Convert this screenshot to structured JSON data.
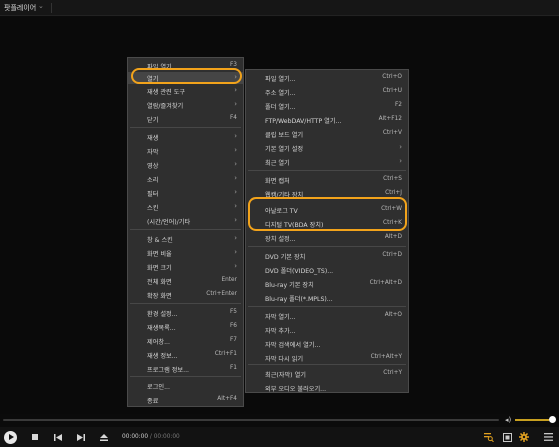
{
  "app": {
    "title": "팟플레이어",
    "chevron_icon": "chevron-down-icon"
  },
  "accent_color": "#f2a31b",
  "main_menu": {
    "items": [
      {
        "label": "파일 열기...",
        "shortcut": "F3",
        "arrow": ""
      },
      {
        "label": "열기",
        "shortcut": "",
        "arrow": "›"
      },
      {
        "label": "재생 관련 도구",
        "shortcut": "",
        "arrow": "›"
      },
      {
        "label": "열람/즐겨찾기",
        "shortcut": "",
        "arrow": "›"
      },
      {
        "label": "닫기",
        "shortcut": "F4",
        "arrow": ""
      },
      {
        "label": "재생",
        "shortcut": "",
        "arrow": "›"
      },
      {
        "label": "자막",
        "shortcut": "",
        "arrow": "›"
      },
      {
        "label": "영상",
        "shortcut": "",
        "arrow": "›"
      },
      {
        "label": "소리",
        "shortcut": "",
        "arrow": "›"
      },
      {
        "label": "필터",
        "shortcut": "",
        "arrow": "›"
      },
      {
        "label": "스킨",
        "shortcut": "",
        "arrow": "›"
      },
      {
        "label": "(시간/언어)/기타",
        "shortcut": "",
        "arrow": "›"
      },
      {
        "label": "창 & 스킨",
        "shortcut": "",
        "arrow": "›"
      },
      {
        "label": "화면 비율",
        "shortcut": "",
        "arrow": "›"
      },
      {
        "label": "화면 크기",
        "shortcut": "",
        "arrow": "›"
      },
      {
        "label": "전체 화면",
        "shortcut": "Enter",
        "arrow": ""
      },
      {
        "label": "확장 화면",
        "shortcut": "Ctrl+Enter",
        "arrow": ""
      },
      {
        "label": "환경 설정...",
        "shortcut": "F5",
        "arrow": ""
      },
      {
        "label": "재생목록...",
        "shortcut": "F6",
        "arrow": ""
      },
      {
        "label": "제어창...",
        "shortcut": "F7",
        "arrow": ""
      },
      {
        "label": "재생 정보...",
        "shortcut": "Ctrl+F1",
        "arrow": ""
      },
      {
        "label": "프로그램 정보...",
        "shortcut": "F1",
        "arrow": ""
      },
      {
        "label": "로그인...",
        "shortcut": "",
        "arrow": ""
      },
      {
        "label": "종료",
        "shortcut": "Alt+F4",
        "arrow": ""
      }
    ]
  },
  "open_submenu": {
    "items": [
      {
        "label": "파일 열기...",
        "shortcut": "Ctrl+O",
        "arrow": ""
      },
      {
        "label": "주소 열기...",
        "shortcut": "Ctrl+U",
        "arrow": ""
      },
      {
        "label": "폴더 열기...",
        "shortcut": "F2",
        "arrow": ""
      },
      {
        "label": "FTP/WebDAV/HTTP 열기...",
        "shortcut": "Alt+F12",
        "arrow": ""
      },
      {
        "label": "클립 보드 열기",
        "shortcut": "Ctrl+V",
        "arrow": ""
      },
      {
        "label": "기본 열기 설정",
        "shortcut": "",
        "arrow": "›"
      },
      {
        "label": "최근 열기",
        "shortcut": "",
        "arrow": "›"
      },
      {
        "label": "화면 캡처",
        "shortcut": "Ctrl+S",
        "arrow": ""
      },
      {
        "label": "웹캠/기타 장치",
        "shortcut": "Ctrl+J",
        "arrow": ""
      },
      {
        "label": "아날로그 TV",
        "shortcut": "Ctrl+W",
        "arrow": ""
      },
      {
        "label": "디지털 TV(BDA 장치)",
        "shortcut": "Ctrl+K",
        "arrow": ""
      },
      {
        "label": "장치 설정...",
        "shortcut": "Alt+D",
        "arrow": ""
      },
      {
        "label": "DVD 기본 장치",
        "shortcut": "Ctrl+D",
        "arrow": ""
      },
      {
        "label": "DVD 폴더(VIDEO_TS)...",
        "shortcut": "",
        "arrow": ""
      },
      {
        "label": "Blu-ray 기본 장치",
        "shortcut": "Ctrl+Alt+D",
        "arrow": ""
      },
      {
        "label": "Blu-ray 폴더(*.MPLS)...",
        "shortcut": "",
        "arrow": ""
      },
      {
        "label": "자막 열기...",
        "shortcut": "Alt+O",
        "arrow": ""
      },
      {
        "label": "자막 추가...",
        "shortcut": "",
        "arrow": ""
      },
      {
        "label": "자막 검색에서 열기...",
        "shortcut": "",
        "arrow": ""
      },
      {
        "label": "자막 다시 읽기",
        "shortcut": "Ctrl+Alt+Y",
        "arrow": ""
      },
      {
        "label": "최근(자막) 열기",
        "shortcut": "Ctrl+Y",
        "arrow": ""
      },
      {
        "label": "외부 오디오 불러오기...",
        "shortcut": "",
        "arrow": ""
      }
    ]
  },
  "controls": {
    "current_time": "00:00:00",
    "separator": "/",
    "duration": "00:00:00",
    "volume_level": 0.95,
    "icons": {
      "play": "play-icon",
      "stop": "stop-icon",
      "prev": "previous-icon",
      "next": "next-icon",
      "eject": "eject-icon",
      "volume": "volume-icon",
      "search": "search-icon",
      "playlist": "playlist-icon",
      "settings": "gear-icon",
      "menu": "hamburger-icon"
    }
  }
}
